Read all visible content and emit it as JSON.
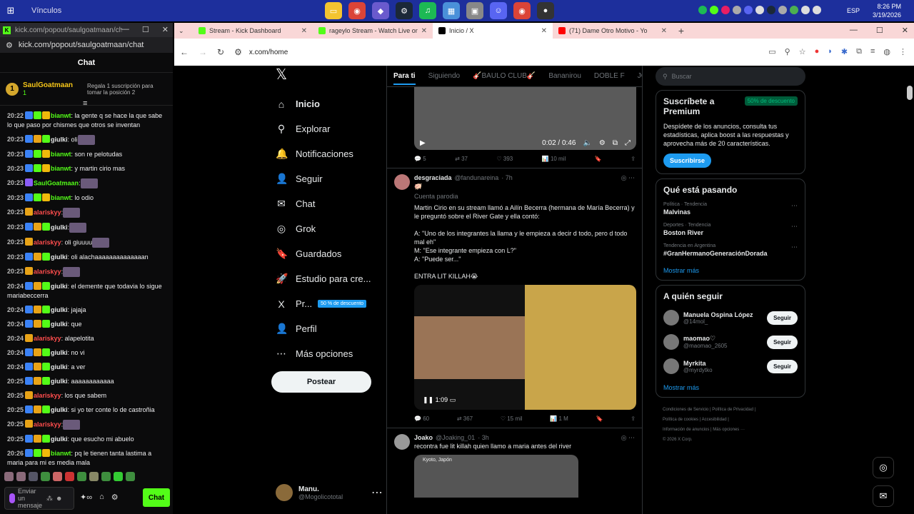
{
  "taskbar": {
    "title": "Vínculos",
    "time": "8:26 PM",
    "date": "3/19/2026",
    "lang": "ESP"
  },
  "chatwin": {
    "url": "kick.com/popout/saulgoatmaan/chat",
    "address": "kick.com/popout/saulgoatmaan/chat",
    "header": "Chat",
    "pinned": {
      "name": "SaulGoatmaan",
      "count": "1",
      "rank": "1",
      "gift": "Regala 1 suscripción para tomar la posición 2"
    },
    "messages": [
      {
        "t": "20:22",
        "u": "bianwt",
        "c": "#53fc18",
        "m": ": la gente q se hace la que sabe lo que paso por chismes que otros se inventan",
        "b": [
          "blue",
          "green",
          "gold"
        ]
      },
      {
        "t": "20:23",
        "u": "giulki",
        "c": "#e7e9ea",
        "m": ": oli",
        "b": [
          "blue",
          "crown",
          "green"
        ],
        "e": 1
      },
      {
        "t": "20:23",
        "u": "bianwt",
        "c": "#53fc18",
        "m": ": son re pelotudas",
        "b": [
          "blue",
          "green",
          "gold"
        ]
      },
      {
        "t": "20:23",
        "u": "bianwt",
        "c": "#53fc18",
        "m": ": y martin cirio mas",
        "b": [
          "blue",
          "green",
          "gold"
        ]
      },
      {
        "t": "20:23",
        "u": "SaulGoatmaan",
        "c": "#53fc18",
        "m": ":",
        "b": [
          "purple"
        ],
        "e": 1
      },
      {
        "t": "20:23",
        "u": "bianwt",
        "c": "#53fc18",
        "m": ": lo odio",
        "b": [
          "blue",
          "green",
          "gold"
        ]
      },
      {
        "t": "20:23",
        "u": "alariskyy",
        "c": "#ff4d4d",
        "m": ":",
        "b": [
          "crown"
        ],
        "e": 1
      },
      {
        "t": "20:23",
        "u": "giulki",
        "c": "#e7e9ea",
        "m": ":",
        "b": [
          "blue",
          "crown",
          "green"
        ],
        "e": 1
      },
      {
        "t": "20:23",
        "u": "alariskyy",
        "c": "#ff4d4d",
        "m": ": oli giuuuu",
        "b": [
          "crown"
        ],
        "e": 1
      },
      {
        "t": "20:23",
        "u": "giulki",
        "c": "#e7e9ea",
        "m": ": oli alachaaaaaaaaaaaaaan",
        "b": [
          "blue",
          "crown",
          "green"
        ]
      },
      {
        "t": "20:23",
        "u": "alariskyy",
        "c": "#ff4d4d",
        "m": ":",
        "b": [
          "crown"
        ],
        "e": 1
      },
      {
        "t": "20:24",
        "u": "giulki",
        "c": "#e7e9ea",
        "m": ": el demente que todavia lo sigue mariabeccerra",
        "b": [
          "blue",
          "crown",
          "green"
        ]
      },
      {
        "t": "20:24",
        "u": "giulki",
        "c": "#e7e9ea",
        "m": ": jajaja",
        "b": [
          "blue",
          "crown",
          "green"
        ]
      },
      {
        "t": "20:24",
        "u": "giulki",
        "c": "#e7e9ea",
        "m": ": que",
        "b": [
          "blue",
          "crown",
          "green"
        ]
      },
      {
        "t": "20:24",
        "u": "alariskyy",
        "c": "#ff4d4d",
        "m": ": alapelotita",
        "b": [
          "crown"
        ]
      },
      {
        "t": "20:24",
        "u": "giulki",
        "c": "#e7e9ea",
        "m": ": no vi",
        "b": [
          "blue",
          "crown",
          "green"
        ]
      },
      {
        "t": "20:24",
        "u": "giulki",
        "c": "#e7e9ea",
        "m": ": a ver",
        "b": [
          "blue",
          "crown",
          "green"
        ]
      },
      {
        "t": "20:25",
        "u": "giulki",
        "c": "#e7e9ea",
        "m": ": aaaaaaaaaaaa",
        "b": [
          "blue",
          "crown",
          "green"
        ]
      },
      {
        "t": "20:25",
        "u": "alariskyy",
        "c": "#ff4d4d",
        "m": ": los que sabem",
        "b": [
          "crown"
        ]
      },
      {
        "t": "20:25",
        "u": "giulki",
        "c": "#e7e9ea",
        "m": ": si yo ter conte lo de castroñia",
        "b": [
          "blue",
          "crown",
          "green"
        ]
      },
      {
        "t": "20:25",
        "u": "alariskyy",
        "c": "#ff4d4d",
        "m": ":",
        "b": [
          "crown"
        ],
        "e": 1
      },
      {
        "t": "20:25",
        "u": "giulki",
        "c": "#e7e9ea",
        "m": ": que esucho mi abuelo",
        "b": [
          "blue",
          "crown",
          "green"
        ]
      },
      {
        "t": "20:26",
        "u": "bianwt",
        "c": "#53fc18",
        "m": ": pq le tienen tanta lastima a maria para mi es media mala",
        "b": [
          "blue",
          "green",
          "gold"
        ]
      }
    ],
    "input_placeholder": "Enviar un mensaje",
    "send": "Chat"
  },
  "browser": {
    "tabs": [
      {
        "title": "Stream - Kick Dashboard",
        "color": "#53fc18"
      },
      {
        "title": "rageylo Stream - Watch Live on",
        "color": "#53fc18"
      },
      {
        "title": "Inicio / X",
        "color": "#000000"
      },
      {
        "title": "(71) Dame Otro Motivo - Yo",
        "color": "#ff0000"
      }
    ],
    "url": "x.com/home"
  },
  "x": {
    "nav": [
      {
        "label": "Inicio",
        "icon": "⌂",
        "bold": true
      },
      {
        "label": "Explorar",
        "icon": "⚲"
      },
      {
        "label": "Notificaciones",
        "icon": "🔔"
      },
      {
        "label": "Seguir",
        "icon": "👤"
      },
      {
        "label": "Chat",
        "icon": "✉"
      },
      {
        "label": "Grok",
        "icon": "◎"
      },
      {
        "label": "Guardados",
        "icon": "🔖"
      },
      {
        "label": "Estudio para cre...",
        "icon": "🚀"
      },
      {
        "label": "Pr...",
        "icon": "X",
        "promo": "50 % de descuento"
      },
      {
        "label": "Perfil",
        "icon": "👤"
      },
      {
        "label": "Más opciones",
        "icon": "⋯"
      }
    ],
    "post": "Postear",
    "user": {
      "name": "Manu.",
      "handle": "@Mogolicototal"
    },
    "feedtabs": [
      "Para ti",
      "Siguiendo",
      "🎸BAULO CLUB🎸",
      "Bananirou",
      "DOBLE F",
      "JOSE"
    ],
    "tweet0": {
      "time": "0:02 / 0:46",
      "replies": "5",
      "rts": "37",
      "likes": "393",
      "views": "10 mil"
    },
    "tweet1": {
      "name": "desgraciada",
      "handle": "@fandunareina",
      "age": "· 7h",
      "emoji": "🐖",
      "parody": "Cuenta parodia",
      "text1": "Martin Cirio en su stream llamó a Ailín Becerra (hermana de María Becerra) y le preguntó sobre el River Gate y ella contó:",
      "text2": "A: \"Uno de los integrantes la llama y le empieza a decir d todo, pero d todo mal eh\"",
      "text3": "M: \"Ese integrante empieza con L?\"",
      "text4": "A: \"Puede ser...\"",
      "text5": "ENTRA LIT KILLAH😭",
      "vtime": "1:09",
      "replies": "60",
      "rts": "367",
      "likes": "15 mil",
      "views": "1 M"
    },
    "tweet2": {
      "name": "Joako",
      "handle": "@Joaking_01",
      "age": "· 3h",
      "text": "recontra fue lit killah quien llamo a maria antes del river",
      "loc": "Kyoto, Japón"
    },
    "search": "Buscar",
    "premium": {
      "title": "Suscríbete a Premium",
      "tag": "50% de descuento",
      "text": "Despídete de los anuncios, consulta tus estadísticas, aplica boost a las respuestas y aprovecha más de 20 características.",
      "btn": "Suscribirse"
    },
    "trends_title": "Qué está pasando",
    "trends": [
      {
        "cat": "Política · Tendencia",
        "name": "Malvinas"
      },
      {
        "cat": "Deportes · Tendencia",
        "name": "Boston River"
      },
      {
        "cat": "Tendencia en Argentina",
        "name": "#GranHermanoGeneraciónDorada"
      }
    ],
    "more": "Mostrar más",
    "follow_title": "A quién seguir",
    "follows": [
      {
        "name": "Manuela Ospina López",
        "handle": "@14mol_"
      },
      {
        "name": "maomao♡",
        "handle": "@maomao_2605"
      },
      {
        "name": "Myrkita",
        "handle": "@myrdytko"
      }
    ],
    "follow_btn": "Seguir",
    "footer": [
      "Condiciones de Servicio | Política de Privacidad |",
      "Política de cookies | Accesibilidad |",
      "Información de anuncios | Más opciones ···",
      "© 2026 X Corp."
    ]
  }
}
